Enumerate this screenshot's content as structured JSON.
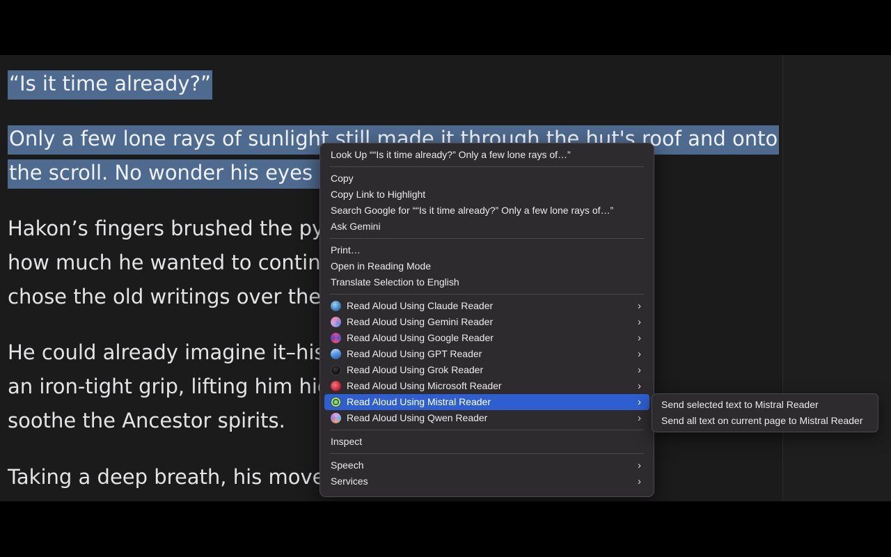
{
  "reader": {
    "paragraphs": [
      {
        "lines": [
          {
            "highlighted": "“Is it time already?”",
            "rest": ""
          }
        ]
      },
      {
        "lines": [
          {
            "highlighted": "Only a few lone rays of sunlight still made it through the hut's roof and onto",
            "rest": ""
          },
          {
            "highlighted": "the scroll. No wonder his eyes w",
            "rest": ""
          }
        ]
      },
      {
        "lines": [
          {
            "highlighted": "",
            "rest": "Hakon’s fingers brushed the pyr                                          o matter"
          },
          {
            "highlighted": "",
            "rest": "how much he wanted to continu                                          nces? If he"
          },
          {
            "highlighted": "",
            "rest": "chose the old writings over the I                                          rally."
          }
        ]
      },
      {
        "lines": [
          {
            "highlighted": "",
            "rest": "He could already imagine it–his                                          throat in"
          },
          {
            "highlighted": "",
            "rest": "an iron-tight grip, lifting him hig                                          nped to"
          },
          {
            "highlighted": "",
            "rest": "soothe the Ancestor spirits."
          }
        ]
      },
      {
        "lines": [
          {
            "highlighted": "",
            "rest": "Taking a deep breath, his moves                                          ed the hide"
          }
        ]
      }
    ]
  },
  "context_menu": {
    "look_up": "Look Up ““Is it time already?”  Only a few lone rays of…”",
    "copy": "Copy",
    "copy_link": "Copy Link to Highlight",
    "search_google": "Search Google for ““Is it time already?”  Only a few lone rays of…”",
    "ask_gemini": "Ask Gemini",
    "print": "Print…",
    "reading_mode": "Open in Reading Mode",
    "translate": "Translate Selection to English",
    "readers": [
      {
        "label": "Read Aloud Using Claude Reader",
        "icon": "claude-reader-icon"
      },
      {
        "label": "Read Aloud Using Gemini Reader",
        "icon": "gemini-reader-icon"
      },
      {
        "label": "Read Aloud Using Google Reader",
        "icon": "google-reader-icon"
      },
      {
        "label": "Read Aloud Using GPT Reader",
        "icon": "gpt-reader-icon"
      },
      {
        "label": "Read Aloud Using Grok Reader",
        "icon": "grok-reader-icon"
      },
      {
        "label": "Read Aloud Using Microsoft Reader",
        "icon": "microsoft-reader-icon"
      },
      {
        "label": "Read Aloud Using Mistral Reader",
        "icon": "mistral-reader-icon",
        "active": true
      },
      {
        "label": "Read Aloud Using Qwen Reader",
        "icon": "qwen-reader-icon"
      }
    ],
    "inspect": "Inspect",
    "speech": "Speech",
    "services": "Services",
    "chevron": "›"
  },
  "submenu": {
    "send_selected": "Send selected text to Mistral Reader",
    "send_all": "Send all text on current page to Mistral Reader"
  },
  "colors": {
    "highlight": "#4e6a8e",
    "menu_active": "#2f5fcf",
    "menu_bg": "#2d2b2e"
  }
}
